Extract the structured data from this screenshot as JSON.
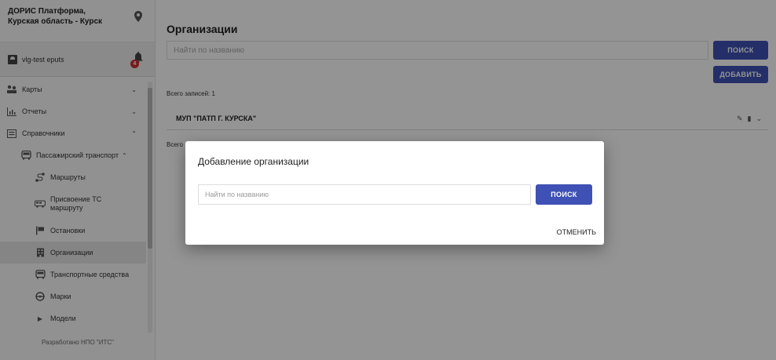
{
  "sidebar": {
    "title": "ДОРИС Платформа, Курская область - Курск",
    "user": "vlg-test eputs",
    "notifications": "4",
    "menu": [
      {
        "label": "Карты"
      },
      {
        "label": "Отчеты"
      },
      {
        "label": "Справочники"
      },
      {
        "label": "Пассажирский транспорт"
      },
      {
        "label": "Маршруты"
      },
      {
        "label": "Присвоение ТС маршруту"
      },
      {
        "label": "Остановки"
      },
      {
        "label": "Организации"
      },
      {
        "label": "Транспортные средства"
      },
      {
        "label": "Марки"
      },
      {
        "label": "Модели"
      }
    ],
    "footer": "Разработано НПО \"ИТС\""
  },
  "main": {
    "title": "Организации",
    "search_placeholder": "Найти по названию",
    "search_button": "поиск",
    "add_button": "добавить",
    "total_top": "Всего записей: 1",
    "organizations": [
      {
        "name": "МУП \"ПАТП Г. КУРСКА\""
      }
    ],
    "total_bottom": "Всего"
  },
  "dialog": {
    "title": "Добавление организации",
    "search_placeholder": "Найти по названию",
    "search_button": "поиск",
    "cancel_button": "отменить"
  }
}
